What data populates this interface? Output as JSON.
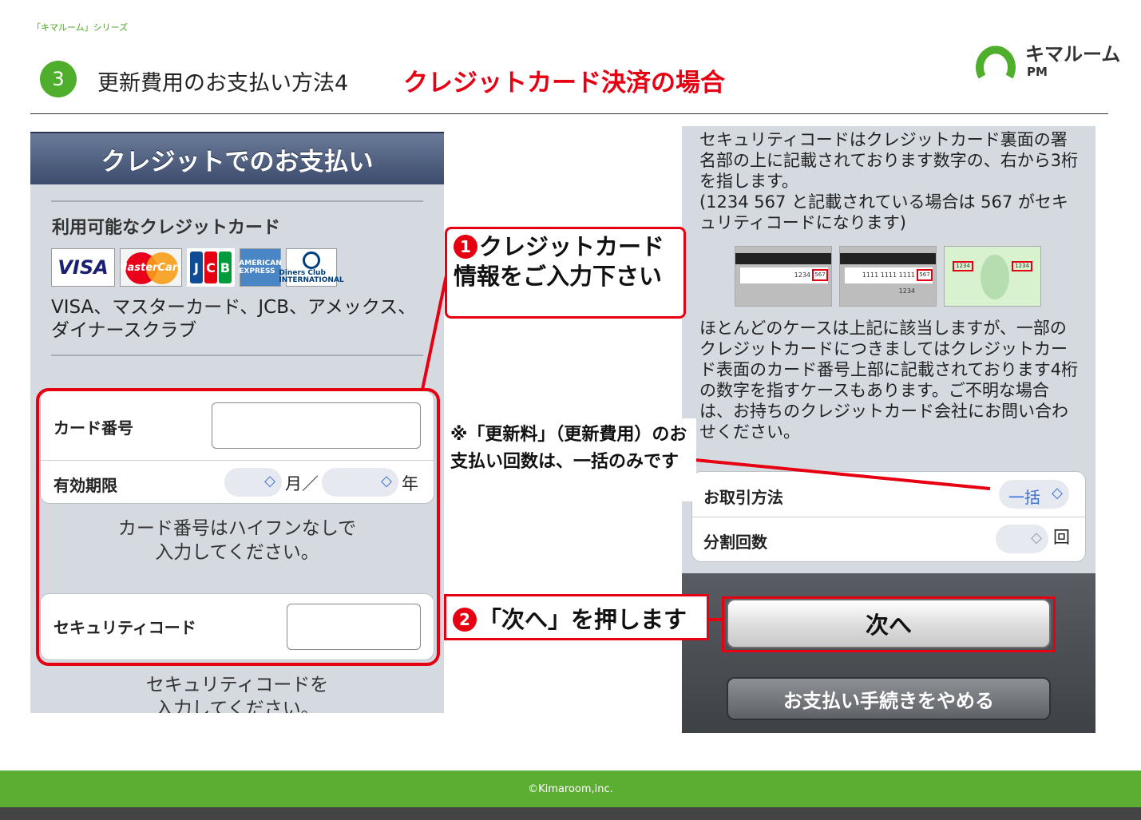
{
  "series_label": "「キマルーム」シリーズ",
  "header": {
    "step_number": "3",
    "title": "更新費用のお支払い方法4",
    "subtitle": "クレジットカード決済の場合"
  },
  "logo": {
    "name": "キマルーム",
    "sub": "PM"
  },
  "left_panel": {
    "title": "クレジットでのお支払い",
    "available_label": "利用可能なクレジットカード",
    "card_logos": [
      "VISA",
      "MasterCard",
      "JCB",
      "AMERICAN EXPRESS",
      "Diners Club INTERNATIONAL"
    ],
    "cards_text": "VISA、マスターカード、JCB、アメックス、ダイナースクラブ",
    "card_number_label": "カード番号",
    "card_number_value": "",
    "expiry_label": "有効期限",
    "month_unit": "月／",
    "year_unit": "年",
    "card_hint_1": "カード番号はハイフンなしで",
    "card_hint_2": "入力してください。",
    "security_label": "セキュリティコード",
    "security_value": "",
    "security_hint_1": "セキュリティコードを",
    "security_hint_2": "入力してください。"
  },
  "callouts": {
    "step1_num": "1",
    "step1_text": "クレジットカード情報をご入力下さい",
    "note": "※「更新料」（更新費用）のお支払い回数は、一括のみです",
    "step2_num": "2",
    "step2_text": "「次へ」を押します"
  },
  "right_panel": {
    "security_desc_1": "セキュリティコードはクレジットカード裏面の署名部の上に記載されております数字の、右から3桁を指します。",
    "security_desc_2": "(1234 567 と記載されている場合は 567 がセキュリティコードになります)",
    "sample1_digits": "1234",
    "sample1_code": "567",
    "sample2_digits": "1111 1111 1111 1234",
    "sample2_code": "567",
    "sample3_left": "1234",
    "sample3_right": "1234",
    "front_desc": "ほとんどのケースは上記に該当しますが、一部のクレジットカードにつきましてはクレジットカード表面のカード番号上部に記載されております4桁の数字を指すケースもあります。ご不明な場合は、お持ちのクレジットカード会社にお問い合わせください。",
    "transaction_label": "お取引方法",
    "transaction_value": "一括",
    "installments_label": "分割回数",
    "installments_unit": "回",
    "next_button": "次へ",
    "cancel_button": "お支払い手続きをやめる"
  },
  "footer": {
    "copyright": "©Kimaroom,inc."
  },
  "colors": {
    "accent_red": "#e60012",
    "brand_green": "#5cae32"
  }
}
